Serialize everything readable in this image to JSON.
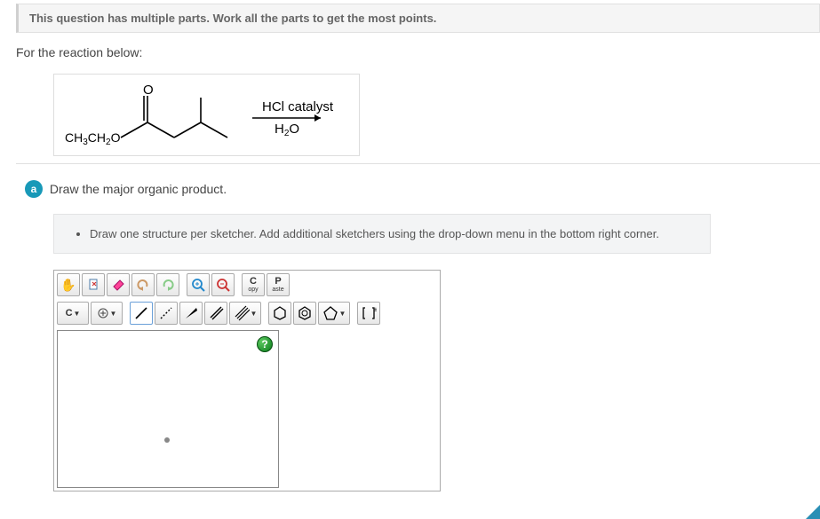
{
  "header": {
    "instruction": "This question has multiple parts. Work all the parts to get the most points."
  },
  "prompt": "For the reaction below:",
  "reaction": {
    "reactant_label": "CH3CH2O",
    "conditions_top": "HCl catalyst",
    "conditions_bottom": "H2O"
  },
  "part": {
    "letter": "a",
    "text": "Draw the major organic product."
  },
  "instruction_box": {
    "bullet1": "Draw one structure per sketcher. Add additional sketchers using the drop-down menu in the bottom right corner."
  },
  "sketcher": {
    "atom_label": "C",
    "copy_top": "C",
    "copy_bot": "opy",
    "paste_top": "P",
    "paste_bot": "aste",
    "help": "?"
  }
}
